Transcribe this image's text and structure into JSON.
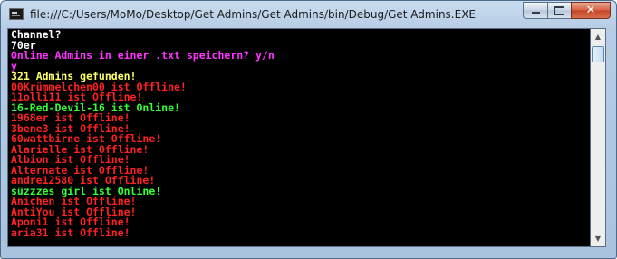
{
  "window": {
    "title": "file:///C:/Users/MoMo/Desktop/Get Admins/Get Admins/bin/Debug/Get Admins.EXE",
    "buttons": {
      "minimize_icon": "minimize-icon",
      "maximize_icon": "maximize-icon",
      "close_label": "✕"
    }
  },
  "scrollbar": {
    "up_glyph": "▲",
    "down_glyph": "▼"
  },
  "colors": {
    "white": "#ffffff",
    "magenta": "#ff33ff",
    "yellow": "#ffff66",
    "red": "#ff2222",
    "green": "#33ff33"
  },
  "console": {
    "lines": [
      {
        "text": "Channel?",
        "color": "white"
      },
      {
        "text": "70er",
        "color": "white"
      },
      {
        "text": "Online Admins in einer .txt speichern? y/n",
        "color": "magenta"
      },
      {
        "text": "y",
        "color": "magenta"
      },
      {
        "text": "321 Admins gefunden!",
        "color": "yellow"
      },
      {
        "text": "00Krümmelchen00 ist Offline!",
        "color": "red"
      },
      {
        "text": "11olli11 ist Offline!",
        "color": "red"
      },
      {
        "text": "16-Red-Devil-16 ist Online!",
        "color": "green"
      },
      {
        "text": "1968er ist Offline!",
        "color": "red"
      },
      {
        "text": "3bene3 ist Offline!",
        "color": "red"
      },
      {
        "text": "60wattbirne ist Offline!",
        "color": "red"
      },
      {
        "text": "Alarielle ist Offline!",
        "color": "red"
      },
      {
        "text": "Albion ist Offline!",
        "color": "red"
      },
      {
        "text": "Alternate ist Offline!",
        "color": "red"
      },
      {
        "text": "andre12580 ist Offline!",
        "color": "red"
      },
      {
        "text": "süzzzes girl ist Online!",
        "color": "green"
      },
      {
        "text": "Anichen ist Offline!",
        "color": "red"
      },
      {
        "text": "AntiYou ist Offline!",
        "color": "red"
      },
      {
        "text": "Aponi1 ist Offline!",
        "color": "red"
      },
      {
        "text": "aria31 ist Offline!",
        "color": "red"
      }
    ]
  }
}
